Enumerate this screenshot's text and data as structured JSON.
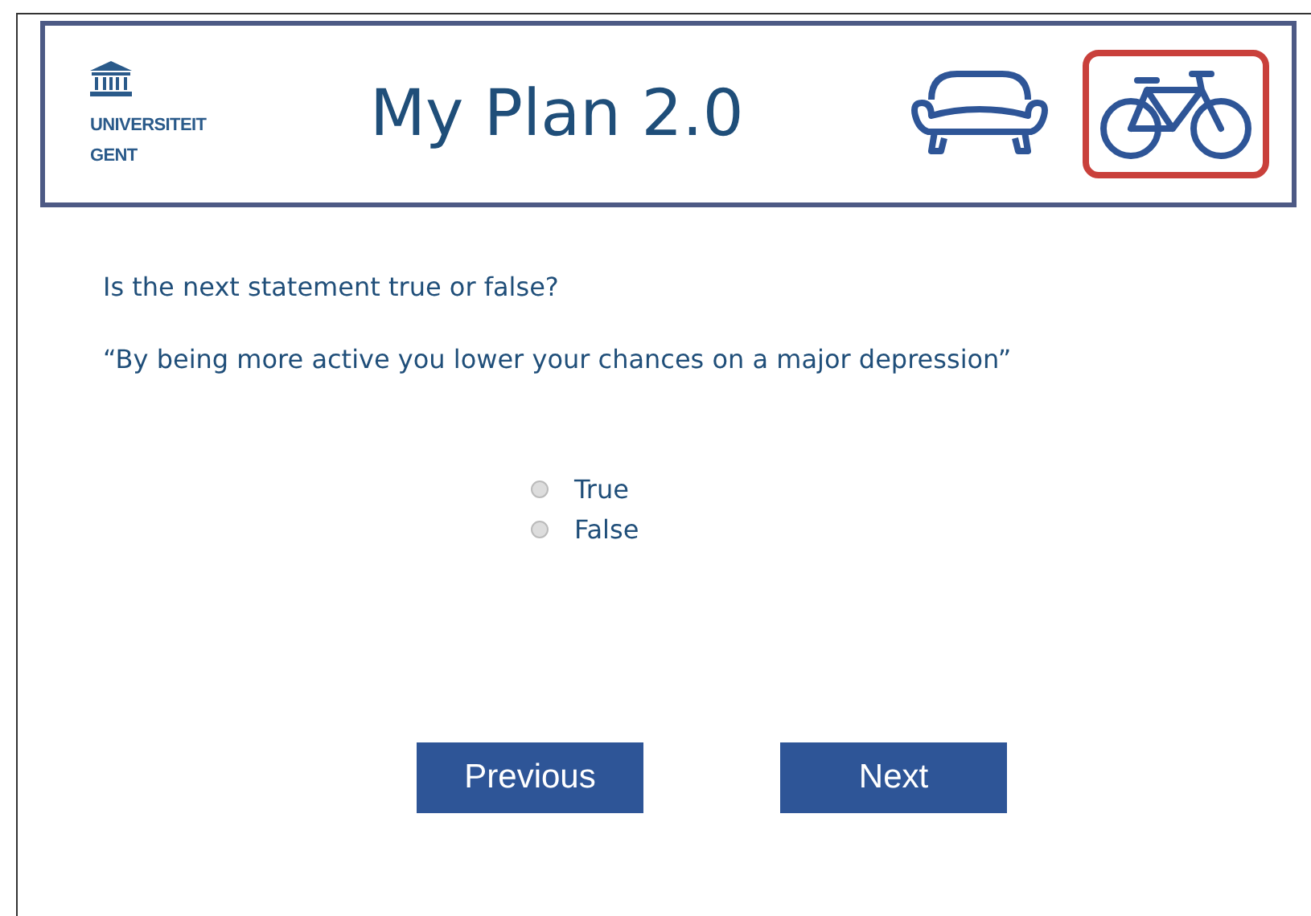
{
  "header": {
    "logo": [
      "UNIVERSITEIT",
      "GENT"
    ],
    "title": "My Plan 2.0",
    "modes": [
      {
        "kind": "couch",
        "selected": false
      },
      {
        "kind": "bike",
        "selected": true
      }
    ]
  },
  "question": "Is the next statement true or false?",
  "statement": "“By being more active you lower your chances on a major depression”",
  "options": [
    {
      "label": "True",
      "selected": false
    },
    {
      "label": "False",
      "selected": false
    }
  ],
  "buttons": [
    "Previous",
    "Next"
  ]
}
